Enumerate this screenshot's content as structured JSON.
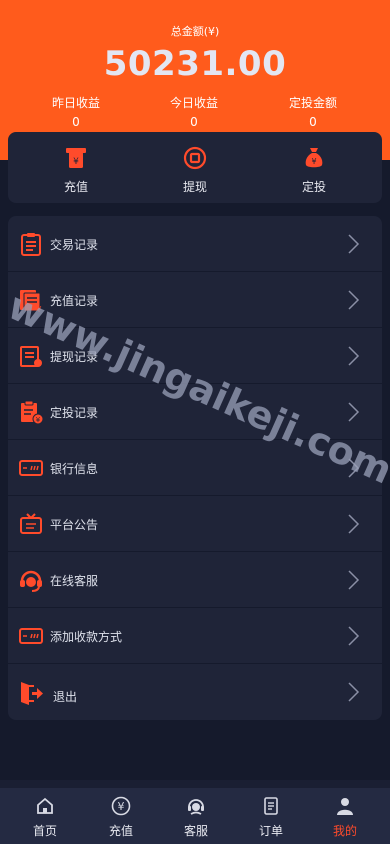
{
  "header": {
    "total_label": "总金额(¥)",
    "total_amount": "50231.00",
    "stats": [
      {
        "label": "昨日收益",
        "value": "0"
      },
      {
        "label": "今日收益",
        "value": "0"
      },
      {
        "label": "定投金额",
        "value": "0"
      }
    ]
  },
  "quick_actions": [
    {
      "label": "充值",
      "icon": "recharge-icon"
    },
    {
      "label": "提现",
      "icon": "withdraw-icon"
    },
    {
      "label": "定投",
      "icon": "money-bag-icon"
    }
  ],
  "menu": [
    {
      "label": "交易记录",
      "icon": "clipboard-icon"
    },
    {
      "label": "充值记录",
      "icon": "recharge-record-icon"
    },
    {
      "label": "提现记录",
      "icon": "withdraw-record-icon"
    },
    {
      "label": "定投记录",
      "icon": "investment-record-icon"
    },
    {
      "label": "银行信息",
      "icon": "bank-card-icon"
    },
    {
      "label": "平台公告",
      "icon": "announcement-icon"
    },
    {
      "label": "在线客服",
      "icon": "headset-icon"
    },
    {
      "label": "添加收款方式",
      "icon": "payment-card-icon"
    },
    {
      "label": "退出",
      "icon": "logout-icon"
    }
  ],
  "watermark": "www.jingaikeji.com",
  "tabs": [
    {
      "label": "首页",
      "icon": "home-icon"
    },
    {
      "label": "充值",
      "icon": "yuan-circle-icon"
    },
    {
      "label": "客服",
      "icon": "service-icon"
    },
    {
      "label": "订单",
      "icon": "order-icon"
    },
    {
      "label": "我的",
      "icon": "user-icon",
      "active": true
    }
  ],
  "colors": {
    "accent": "#ff5b1c",
    "card": "#1f2438",
    "background": "#151a2c",
    "active_tab": "#ff4b2b"
  }
}
